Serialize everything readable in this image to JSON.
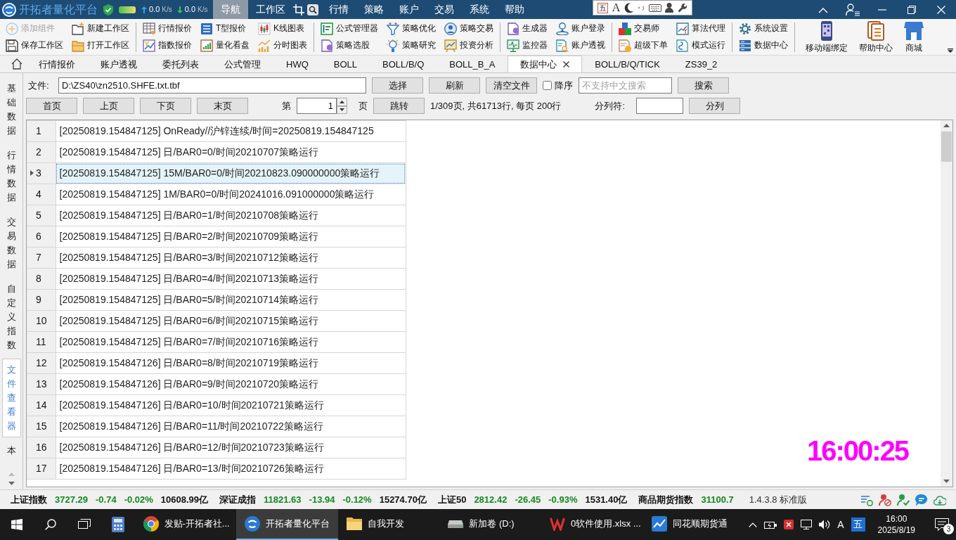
{
  "title_bar": {
    "app_title": "开拓者量化平台",
    "net_speed": {
      "upload": {
        "value": "0.0",
        "unit": "K/s"
      },
      "download": {
        "value": "0.0",
        "unit": "K/s"
      }
    },
    "menus": [
      {
        "label": "导航",
        "selected": true
      },
      {
        "label": "工作区",
        "selected": false
      },
      {
        "label": "行情",
        "selected": false
      },
      {
        "label": "策略",
        "selected": false
      },
      {
        "label": "账户",
        "selected": false
      },
      {
        "label": "交易",
        "selected": false
      },
      {
        "label": "系统",
        "selected": false
      },
      {
        "label": "帮助",
        "selected": false
      }
    ]
  },
  "ime_toolbar": {
    "mode": "五",
    "font": "A"
  },
  "ribbon": {
    "groups": [
      {
        "items": [
          {
            "label": "添加组件",
            "disabled": true
          },
          {
            "label": "保存工作区",
            "disabled": false
          },
          {
            "label": "新建工作区",
            "disabled": false
          },
          {
            "label": "打开工作区",
            "disabled": false
          }
        ]
      },
      {
        "items": [
          {
            "label": "行情报价",
            "disabled": false
          },
          {
            "label": "指数报价",
            "disabled": false
          },
          {
            "label": "T型报价",
            "disabled": false
          },
          {
            "label": "量化看盘",
            "disabled": false
          },
          {
            "label": "K线图表",
            "disabled": false
          },
          {
            "label": "分时图表",
            "disabled": false
          }
        ]
      },
      {
        "items": [
          {
            "label": "公式管理器",
            "disabled": false
          },
          {
            "label": "策略选股",
            "disabled": false
          },
          {
            "label": "策略优化",
            "disabled": false
          },
          {
            "label": "策略研究",
            "disabled": false
          },
          {
            "label": "策略交易",
            "disabled": false
          },
          {
            "label": "投资分析",
            "disabled": false
          }
        ]
      },
      {
        "items": [
          {
            "label": "生成器",
            "disabled": false
          },
          {
            "label": "监控器",
            "disabled": false
          },
          {
            "label": "账户登录",
            "disabled": false
          },
          {
            "label": "账户透视",
            "disabled": false
          }
        ]
      },
      {
        "items": [
          {
            "label": "交易师",
            "disabled": false
          },
          {
            "label": "超级下单",
            "disabled": false
          },
          {
            "label": "算法代理",
            "disabled": false
          },
          {
            "label": "模式运行",
            "disabled": false
          }
        ]
      },
      {
        "items": [
          {
            "label": "系统设置",
            "disabled": false
          },
          {
            "label": "数据中心",
            "disabled": false
          }
        ]
      }
    ],
    "large_buttons": [
      "移动端绑定",
      "帮助中心",
      "商城"
    ]
  },
  "tabs": [
    {
      "label": "行情报价",
      "selected": false
    },
    {
      "label": "账户透视",
      "selected": false
    },
    {
      "label": "委托列表",
      "selected": false
    },
    {
      "label": "公式管理",
      "selected": false
    },
    {
      "label": "HWQ",
      "selected": false
    },
    {
      "label": "BOLL",
      "selected": false
    },
    {
      "label": "BOLL/B/Q",
      "selected": false
    },
    {
      "label": "BOLL_B_A",
      "selected": false
    },
    {
      "label": "数据中心",
      "selected": true
    },
    {
      "label": "BOLL/B/Q/TICK",
      "selected": false
    },
    {
      "label": "ZS39_2",
      "selected": false
    }
  ],
  "sidebar": {
    "items": [
      {
        "label": "基础数据",
        "selected": false
      },
      {
        "label": "行情数据",
        "selected": false
      },
      {
        "label": "交易数据",
        "selected": false
      },
      {
        "label": "自定义指数",
        "selected": false
      },
      {
        "label": "文件查看器",
        "selected": true
      },
      {
        "label": "本",
        "selected": false
      }
    ]
  },
  "file_viewer": {
    "file_label": "文件:",
    "file_path": "D:\\ZS40\\zn2510.SHFE.txt.tbf",
    "file_buttons": [
      "选择",
      "刷新",
      "清空文件"
    ],
    "descending": {
      "label": "降序",
      "checked": false
    },
    "search": {
      "placeholder": "不支持中文搜索"
    },
    "search_button": "搜索",
    "page_buttons": [
      "首页",
      "上页",
      "下页",
      "末页"
    ],
    "page_prefix": "第",
    "page_number": "1",
    "page_suffix": "页",
    "jump_button": "跳转",
    "page_info": "1/309页, 共61713行, 每页 200行",
    "delimiter_label": "分列符:",
    "split_button": "分列"
  },
  "log_table": {
    "rows": [
      {
        "number": "1",
        "text": "[20250819.154847125] OnReady//沪锌连续/时间=20250819.154847125",
        "selected": false
      },
      {
        "number": "2",
        "text": "[20250819.154847125] 日/BAR0=0/时间20210707策略运行",
        "selected": false
      },
      {
        "number": "3",
        "text": "[20250819.154847125] 15M/BAR0=0/时间20210823.090000000策略运行",
        "selected": true
      },
      {
        "number": "4",
        "text": "[20250819.154847125] 1M/BAR0=0/时间20241016.091000000策略运行",
        "selected": false
      },
      {
        "number": "5",
        "text": "[20250819.154847125] 日/BAR0=1/时间20210708策略运行",
        "selected": false
      },
      {
        "number": "6",
        "text": "[20250819.154847125] 日/BAR0=2/时间20210709策略运行",
        "selected": false
      },
      {
        "number": "7",
        "text": "[20250819.154847125] 日/BAR0=3/时间20210712策略运行",
        "selected": false
      },
      {
        "number": "8",
        "text": "[20250819.154847125] 日/BAR0=4/时间20210713策略运行",
        "selected": false
      },
      {
        "number": "9",
        "text": "[20250819.154847125] 日/BAR0=5/时间20210714策略运行",
        "selected": false
      },
      {
        "number": "10",
        "text": "[20250819.154847125] 日/BAR0=6/时间20210715策略运行",
        "selected": false
      },
      {
        "number": "11",
        "text": "[20250819.154847125] 日/BAR0=7/时间20210716策略运行",
        "selected": false
      },
      {
        "number": "12",
        "text": "[20250819.154847126] 日/BAR0=8/时间20210719策略运行",
        "selected": false
      },
      {
        "number": "13",
        "text": "[20250819.154847126] 日/BAR0=9/时间20210720策略运行",
        "selected": false
      },
      {
        "number": "14",
        "text": "[20250819.154847126] 日/BAR0=10/时间20210721策略运行",
        "selected": false
      },
      {
        "number": "15",
        "text": "[20250819.154847126] 日/BAR0=11/时间20210722策略运行",
        "selected": false
      },
      {
        "number": "16",
        "text": "[20250819.154847126] 日/BAR0=12/时间20210723策略运行",
        "selected": false
      },
      {
        "number": "17",
        "text": "[20250819.154847126] 日/BAR0=13/时间20210726策略运行",
        "selected": false
      }
    ]
  },
  "clock_overlay": "16:00:25",
  "status_bar": {
    "indices": [
      {
        "name": "上证指数",
        "price": "3727.29",
        "change": "-0.74",
        "percent": "-0.02%",
        "turnover": "10608.99亿",
        "down": true
      },
      {
        "name": "深证成指",
        "price": "11821.63",
        "change": "-13.94",
        "percent": "-0.12%",
        "turnover": "15274.70亿",
        "down": true
      },
      {
        "name": "上证50",
        "price": "2812.42",
        "change": "-26.45",
        "percent": "-0.93%",
        "turnover": "1531.40亿",
        "down": true
      },
      {
        "name": "商品期货指数",
        "price": "31100.7",
        "down": true
      }
    ],
    "version": "1.4.3.8 标准版"
  },
  "taskbar": {
    "apps": [
      {
        "label": "发贴-开拓者社...",
        "selected": false
      },
      {
        "label": "开拓者量化平台",
        "selected": true
      },
      {
        "label": "自我开发",
        "selected": false
      },
      {
        "label": "新加卷 (D:)",
        "selected": false
      },
      {
        "label": "0软件使用.xlsx ...",
        "selected": false
      },
      {
        "label": "同花顺期货通",
        "selected": false
      }
    ],
    "tray": {
      "input_mode": "A",
      "ime": "五",
      "time": "16:00",
      "date": "2025/8/19",
      "notifications": "3"
    }
  }
}
